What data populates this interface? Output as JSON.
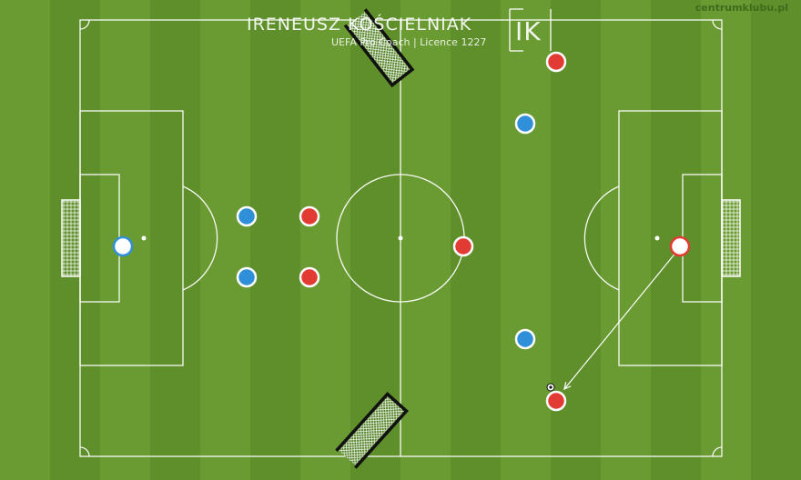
{
  "watermark": {
    "name": "IRENEUSZ KOŚCIELNIAK",
    "subtitle": "UEFA Pro Coach  |  Licence 1227",
    "logo_letters": "IK",
    "site": "centrumklubu.pl"
  },
  "colors": {
    "pitch_light": "#6a9a32",
    "pitch_dark": "#5f8f2a",
    "red_team": "#e23b33",
    "blue_team": "#2f8fd8",
    "neutral": "#ffffff"
  },
  "players": [
    {
      "team": "red",
      "role": "outfield"
    },
    {
      "team": "blue",
      "role": "outfield"
    },
    {
      "team": "blue",
      "role": "outfield"
    },
    {
      "team": "red",
      "role": "outfield"
    },
    {
      "team": "white-blue",
      "role": "goalkeeper"
    },
    {
      "team": "red",
      "role": "outfield"
    },
    {
      "team": "blue",
      "role": "outfield"
    },
    {
      "team": "red",
      "role": "outfield"
    },
    {
      "team": "white-red",
      "role": "goalkeeper"
    },
    {
      "team": "blue",
      "role": "outfield"
    },
    {
      "team": "red",
      "role": "outfield"
    }
  ],
  "icons": [
    "ball-icon",
    "pass-arrow-icon",
    "goal-net-icon"
  ]
}
